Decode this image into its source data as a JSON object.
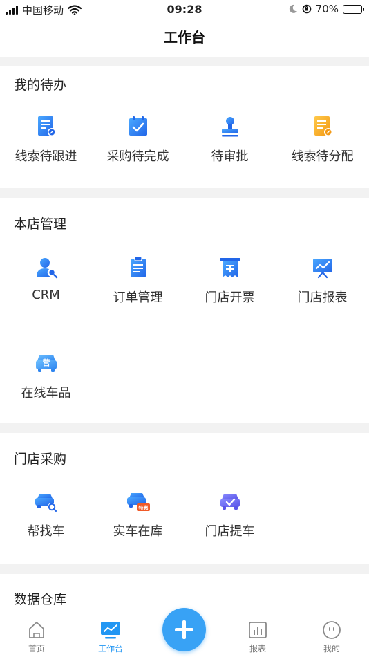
{
  "status_bar": {
    "carrier": "中国移动",
    "time": "09:28",
    "battery": "70%",
    "battery_level": 0.7
  },
  "header": {
    "title": "工作台"
  },
  "todo": {
    "title": "我的待办",
    "items": [
      {
        "label": "线索待跟进",
        "icon": "clue-doc-icon"
      },
      {
        "label": "采购待完成",
        "icon": "calendar-check-icon"
      },
      {
        "label": "待审批",
        "icon": "stamp-icon"
      },
      {
        "label": "线索待分配",
        "icon": "assign-doc-icon"
      }
    ]
  },
  "store": {
    "title": "本店管理",
    "items": [
      {
        "label": "CRM",
        "icon": "user-search-icon"
      },
      {
        "label": "订单管理",
        "icon": "clipboard-icon"
      },
      {
        "label": "门店开票",
        "icon": "invoice-icon"
      },
      {
        "label": "门店报表",
        "icon": "report-board-icon"
      },
      {
        "label": "在线车品",
        "icon": "car-shop-icon",
        "badge": "营"
      }
    ]
  },
  "purchase": {
    "title": "门店采购",
    "items": [
      {
        "label": "帮找车",
        "icon": "car-search-icon"
      },
      {
        "label": "实车在库",
        "icon": "car-special-icon",
        "badge": "特惠"
      },
      {
        "label": "门店提车",
        "icon": "car-pickup-icon"
      }
    ]
  },
  "warehouse": {
    "title": "数据仓库"
  },
  "tabs": [
    {
      "label": "首页",
      "icon": "home-icon"
    },
    {
      "label": "工作台",
      "icon": "workbench-icon",
      "active": true
    },
    {
      "label": "报表",
      "icon": "chart-icon"
    },
    {
      "label": "我的",
      "icon": "profile-icon"
    }
  ],
  "fab": {
    "icon": "plus-icon"
  },
  "colors": {
    "accent": "#2196f3",
    "fab": "#38a2f5",
    "orange": "#f5a623",
    "purple": "#6c63ff"
  }
}
